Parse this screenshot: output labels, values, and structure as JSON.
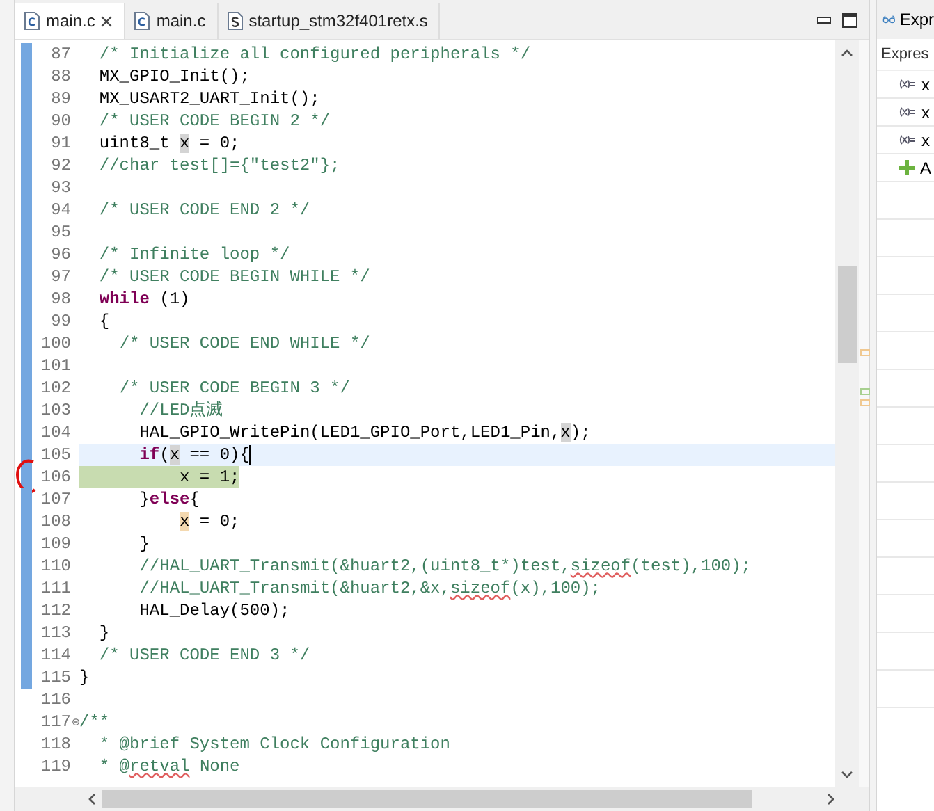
{
  "editor_tabs": [
    {
      "label": "main.c",
      "kind": "source",
      "selected": true,
      "closable": true
    },
    {
      "label": "main.c",
      "kind": "source",
      "selected": false,
      "closable": false
    },
    {
      "label": "startup_stm32f401retx.s",
      "kind": "assembly",
      "selected": false,
      "closable": false
    }
  ],
  "lines": [
    {
      "number": "87",
      "kind": "plain",
      "changed": true,
      "circled": false,
      "segments": [
        {
          "kind": "comment",
          "text": "  /* Initialize all configured peripherals */"
        }
      ]
    },
    {
      "number": "88",
      "kind": "plain",
      "changed": true,
      "circled": false,
      "segments": [
        {
          "kind": "plain",
          "text": "  MX_GPIO_Init();"
        }
      ]
    },
    {
      "number": "89",
      "kind": "plain",
      "changed": true,
      "circled": false,
      "segments": [
        {
          "kind": "plain",
          "text": "  MX_USART2_UART_Init();"
        }
      ]
    },
    {
      "number": "90",
      "kind": "plain",
      "changed": true,
      "circled": false,
      "segments": [
        {
          "kind": "comment",
          "text": "  /* USER CODE BEGIN 2 */"
        }
      ]
    },
    {
      "number": "91",
      "kind": "plain",
      "changed": true,
      "circled": false,
      "segments": [
        {
          "kind": "plain",
          "text": "  uint8_t "
        },
        {
          "kind": "occurrence",
          "text": "x"
        },
        {
          "kind": "plain",
          "text": " = 0;"
        }
      ]
    },
    {
      "number": "92",
      "kind": "plain",
      "changed": true,
      "circled": false,
      "segments": [
        {
          "kind": "comment",
          "text": "  //char test[]={\"test2\"};"
        }
      ]
    },
    {
      "number": "93",
      "kind": "plain",
      "changed": true,
      "circled": false
    },
    {
      "number": "94",
      "kind": "plain",
      "changed": true,
      "circled": false,
      "segments": [
        {
          "kind": "comment",
          "text": "  /* USER CODE END 2 */"
        }
      ]
    },
    {
      "number": "95",
      "kind": "plain",
      "changed": true,
      "circled": false
    },
    {
      "number": "96",
      "kind": "plain",
      "changed": true,
      "circled": false,
      "segments": [
        {
          "kind": "comment",
          "text": "  /* Infinite loop */"
        }
      ]
    },
    {
      "number": "97",
      "kind": "plain",
      "changed": true,
      "circled": false,
      "segments": [
        {
          "kind": "comment",
          "text": "  /* USER CODE BEGIN WHILE */"
        }
      ]
    },
    {
      "number": "98",
      "kind": "plain",
      "changed": true,
      "circled": false,
      "segments": [
        {
          "kind": "keyword",
          "text": "  while"
        },
        {
          "kind": "plain",
          "text": " (1)"
        }
      ]
    },
    {
      "number": "99",
      "kind": "plain",
      "changed": true,
      "circled": false,
      "segments": [
        {
          "kind": "plain",
          "text": "  {"
        }
      ]
    },
    {
      "number": "100",
      "kind": "plain",
      "changed": true,
      "circled": false,
      "segments": [
        {
          "kind": "comment",
          "text": "    /* USER CODE END WHILE */"
        }
      ]
    },
    {
      "number": "101",
      "kind": "plain",
      "changed": true,
      "circled": false
    },
    {
      "number": "102",
      "kind": "plain",
      "changed": true,
      "circled": false,
      "segments": [
        {
          "kind": "comment",
          "text": "    /* USER CODE BEGIN 3 */"
        }
      ]
    },
    {
      "number": "103",
      "kind": "plain",
      "changed": true,
      "circled": false,
      "segments": [
        {
          "kind": "comment",
          "text": "      //LED点滅"
        }
      ]
    },
    {
      "number": "104",
      "kind": "plain",
      "changed": true,
      "circled": false,
      "segments": [
        {
          "kind": "plain",
          "text": "      HAL_GPIO_WritePin(LED1_GPIO_Port,LED1_Pin,"
        },
        {
          "kind": "occurrence",
          "text": "x"
        },
        {
          "kind": "plain",
          "text": ");"
        }
      ]
    },
    {
      "number": "105",
      "kind": "current",
      "changed": true,
      "circled": false,
      "segments": [
        {
          "kind": "keyword",
          "text": "      if"
        },
        {
          "kind": "plain",
          "text": "("
        },
        {
          "kind": "occurrence",
          "text": "x"
        },
        {
          "kind": "plain",
          "text": " == 0){"
        }
      ]
    },
    {
      "number": "106",
      "kind": "debug",
      "changed": true,
      "circled": true,
      "segments": [
        {
          "kind": "plain",
          "text": "          x = 1;"
        }
      ]
    },
    {
      "number": "107",
      "kind": "plain",
      "changed": true,
      "circled": false,
      "segments": [
        {
          "kind": "plain",
          "text": "      }"
        },
        {
          "kind": "keyword",
          "text": "else"
        },
        {
          "kind": "plain",
          "text": "{"
        }
      ]
    },
    {
      "number": "108",
      "kind": "plain",
      "changed": true,
      "circled": false,
      "segments": [
        {
          "kind": "write",
          "text": "          x"
        },
        {
          "kind": "plain",
          "text": " = 0;"
        }
      ]
    },
    {
      "number": "109",
      "kind": "plain",
      "changed": true,
      "circled": false,
      "segments": [
        {
          "kind": "plain",
          "text": "      }"
        }
      ]
    },
    {
      "number": "110",
      "kind": "plain",
      "changed": true,
      "circled": false,
      "segments": [
        {
          "kind": "comment",
          "text": "      //HAL_UART_Transmit(&huart2,(uint8_t*)test,"
        },
        {
          "kind": "spell",
          "text": "sizeof"
        },
        {
          "kind": "comment",
          "text": "(test),100);"
        }
      ]
    },
    {
      "number": "111",
      "kind": "plain",
      "changed": true,
      "circled": false,
      "segments": [
        {
          "kind": "comment",
          "text": "      //HAL_UART_Transmit(&huart2,&x,"
        },
        {
          "kind": "spell",
          "text": "sizeof"
        },
        {
          "kind": "comment",
          "text": "(x),100);"
        }
      ]
    },
    {
      "number": "112",
      "kind": "plain",
      "changed": true,
      "circled": false,
      "segments": [
        {
          "kind": "plain",
          "text": "      HAL_Delay(500);"
        }
      ]
    },
    {
      "number": "113",
      "kind": "plain",
      "changed": true,
      "circled": false,
      "segments": [
        {
          "kind": "plain",
          "text": "  }"
        }
      ]
    },
    {
      "number": "114",
      "kind": "plain",
      "changed": true,
      "circled": false,
      "segments": [
        {
          "kind": "comment",
          "text": "  /* USER CODE END 3 */"
        }
      ]
    },
    {
      "number": "115",
      "kind": "plain",
      "changed": true,
      "circled": false,
      "segments": [
        {
          "kind": "plain",
          "text": "}"
        }
      ]
    },
    {
      "number": "116",
      "kind": "plain",
      "changed": false,
      "circled": false
    },
    {
      "number": "117",
      "kind": "fold",
      "changed": false,
      "circled": false,
      "segments": [
        {
          "kind": "comment",
          "text": "/**"
        }
      ]
    },
    {
      "number": "118",
      "kind": "plain",
      "changed": false,
      "circled": false,
      "segments": [
        {
          "kind": "comment",
          "text": "  * @brief System Clock Configuration"
        }
      ]
    },
    {
      "number": "119",
      "kind": "plain",
      "changed": false,
      "circled": false,
      "segments": [
        {
          "kind": "comment",
          "text": "  * @"
        },
        {
          "kind": "spell",
          "text": "retval"
        },
        {
          "kind": "comment",
          "text": " None"
        }
      ]
    }
  ],
  "expressions": {
    "tab": "Expr",
    "header": "Expres",
    "rows": [
      {
        "kind": "variable",
        "text": "x"
      },
      {
        "kind": "variable",
        "text": "x"
      },
      {
        "kind": "variable",
        "text": "x"
      },
      {
        "kind": "add",
        "text": "A"
      }
    ]
  }
}
